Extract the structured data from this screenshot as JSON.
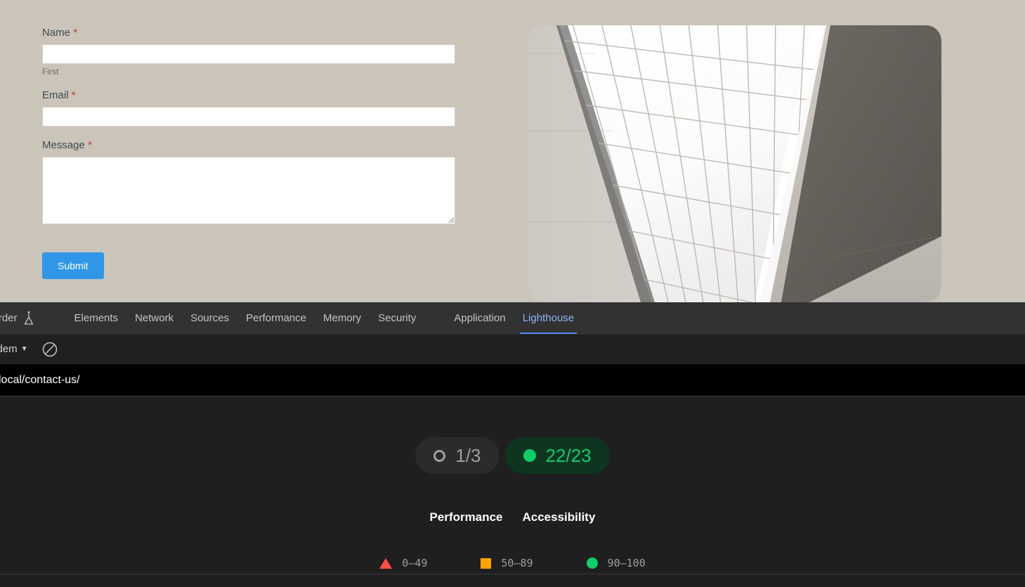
{
  "page": {
    "background_color": "#cbc4b8",
    "form": {
      "fields": [
        {
          "label": "Name",
          "required_marker": "*",
          "value": "",
          "placeholder": "",
          "sub_label": "First"
        },
        {
          "label": "Email",
          "required_marker": "*",
          "value": "",
          "placeholder": "",
          "sub_label": ""
        },
        {
          "label": "Message",
          "required_marker": "*",
          "value": "",
          "placeholder": "",
          "sub_label": ""
        }
      ],
      "submit_label": "Submit",
      "submit_color": "#2f96e8"
    },
    "hero_image_alt": "White grid ceiling with concrete walls in perspective"
  },
  "devtools": {
    "tabs": [
      {
        "label": "Recorder",
        "icon": "flask-icon",
        "active": false,
        "truncated": true,
        "display": "corder"
      },
      {
        "label": "Elements",
        "active": false
      },
      {
        "label": "Network",
        "active": false
      },
      {
        "label": "Sources",
        "active": false
      },
      {
        "label": "Performance",
        "active": false
      },
      {
        "label": "Memory",
        "active": false
      },
      {
        "label": "Security",
        "active": false
      },
      {
        "label": "Application",
        "active": false
      },
      {
        "label": "Lighthouse",
        "active": true
      }
    ],
    "active_tab": "Lighthouse",
    "active_tab_color": "#8ab4f8",
    "toolbar": {
      "context_selector_value": "m-dem",
      "caret": "▼",
      "clear_icon": "clear-ban-icon"
    },
    "urlbar": {
      "url": "local/contact-us/"
    }
  },
  "lighthouse": {
    "pills": [
      {
        "score": "1/3",
        "status": "pending",
        "icon": "gray-ring-icon",
        "color": "#9aa0a6",
        "background": "#2b2b2b"
      },
      {
        "score": "22/23",
        "status": "pass",
        "icon": "green-dot-icon",
        "color": "#0cce6b",
        "background": "#0d3520"
      }
    ],
    "categories": [
      {
        "label": "Performance"
      },
      {
        "label": "Accessibility"
      }
    ],
    "legend": [
      {
        "shape": "triangle",
        "color": "#ff4e42",
        "range": "0–49"
      },
      {
        "shape": "square",
        "color": "#ffa400",
        "range": "50–89"
      },
      {
        "shape": "circle",
        "color": "#0cce6b",
        "range": "90–100"
      }
    ]
  }
}
